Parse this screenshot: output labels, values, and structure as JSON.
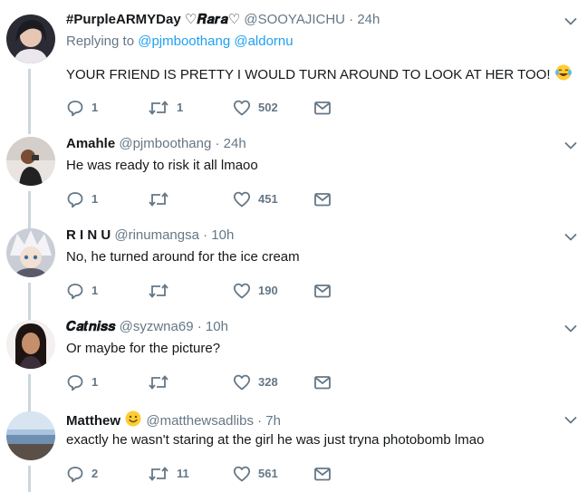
{
  "colors": {
    "text": "#14171a",
    "muted": "#657786",
    "link": "#1da1f2",
    "thread": "#ccd6dd"
  },
  "tweets": [
    {
      "display_name": "#PurpleARMYDay ♡𝑹𝒂𝒓𝒂♡",
      "handle": "@SOOYAJICHU",
      "separator": "·",
      "time": "24h",
      "reply_prefix": "Replying to",
      "reply_mentions": "@pjmboothang @aldornu",
      "text": "YOUR FRIEND IS PRETTY I WOULD TURN AROUND TO LOOK AT HER TOO!",
      "emoji_icon": "laughing-tears-emoji-icon",
      "replies": "1",
      "retweets": "1",
      "likes": "502"
    },
    {
      "display_name": "Amahle",
      "handle": "@pjmboothang",
      "separator": "·",
      "time": "24h",
      "text": "He was ready to risk it all lmaoo",
      "replies": "1",
      "retweets": "",
      "likes": "451"
    },
    {
      "display_name": "R I N U",
      "handle": "@rinumangsa",
      "separator": "·",
      "time": "10h",
      "text": "No, he turned around for the ice cream",
      "replies": "1",
      "retweets": "",
      "likes": "190"
    },
    {
      "display_name": "𝑪𝒂𝒕𝒏𝒊𝒔𝒔",
      "handle": "@syzwna69",
      "separator": "·",
      "time": "10h",
      "text": "Or maybe for the picture?",
      "replies": "1",
      "retweets": "",
      "likes": "328"
    },
    {
      "display_name": "Matthew",
      "name_emoji_icon": "smiley-emoji-icon",
      "handle": "@matthewsadlibs",
      "separator": "·",
      "time": "7h",
      "text": "exactly he wasn't staring at the girl he was just tryna photobomb lmao",
      "replies": "2",
      "retweets": "11",
      "likes": "561"
    }
  ]
}
